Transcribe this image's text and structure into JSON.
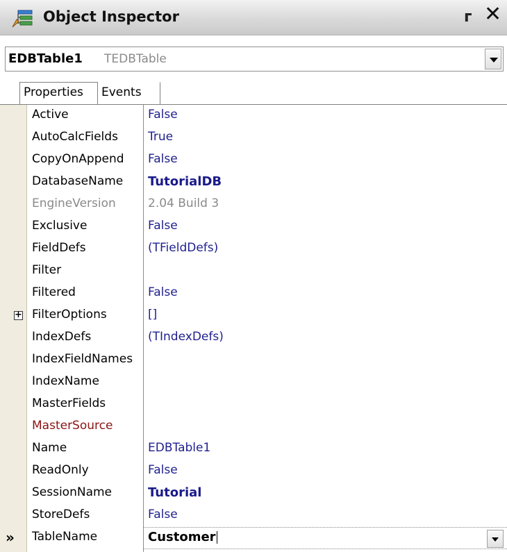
{
  "window": {
    "title": "Object Inspector",
    "pin_glyph": "ᴦ",
    "close_glyph": "✕"
  },
  "component": {
    "name": "EDBTable1",
    "type": "TEDBTable"
  },
  "tabs": [
    {
      "label": "Properties",
      "active": true
    },
    {
      "label": "Events",
      "active": false
    }
  ],
  "properties": [
    {
      "name": "Active",
      "value": "False"
    },
    {
      "name": "AutoCalcFields",
      "value": "True"
    },
    {
      "name": "CopyOnAppend",
      "value": "False"
    },
    {
      "name": "DatabaseName",
      "value": "TutorialDB"
    },
    {
      "name": "EngineVersion",
      "value": "2.04 Build 3"
    },
    {
      "name": "Exclusive",
      "value": "False"
    },
    {
      "name": "FieldDefs",
      "value": "(TFieldDefs)"
    },
    {
      "name": "Filter",
      "value": ""
    },
    {
      "name": "Filtered",
      "value": "False"
    },
    {
      "name": "FilterOptions",
      "value": "[]"
    },
    {
      "name": "IndexDefs",
      "value": "(TIndexDefs)"
    },
    {
      "name": "IndexFieldNames",
      "value": ""
    },
    {
      "name": "IndexName",
      "value": ""
    },
    {
      "name": "MasterFields",
      "value": ""
    },
    {
      "name": "MasterSource",
      "value": ""
    },
    {
      "name": "Name",
      "value": "EDBTable1"
    },
    {
      "name": "ReadOnly",
      "value": "False"
    },
    {
      "name": "SessionName",
      "value": "Tutorial"
    },
    {
      "name": "StoreDefs",
      "value": "False"
    },
    {
      "name": "TableName",
      "value": "Customer"
    }
  ],
  "selection_marker": "»",
  "expand_glyph": "+",
  "colors": {
    "value_text": "#1f1f8f",
    "linked_property": "#8b1414",
    "disabled_text": "#8a8a8a",
    "gutter": "#f0ede0"
  }
}
